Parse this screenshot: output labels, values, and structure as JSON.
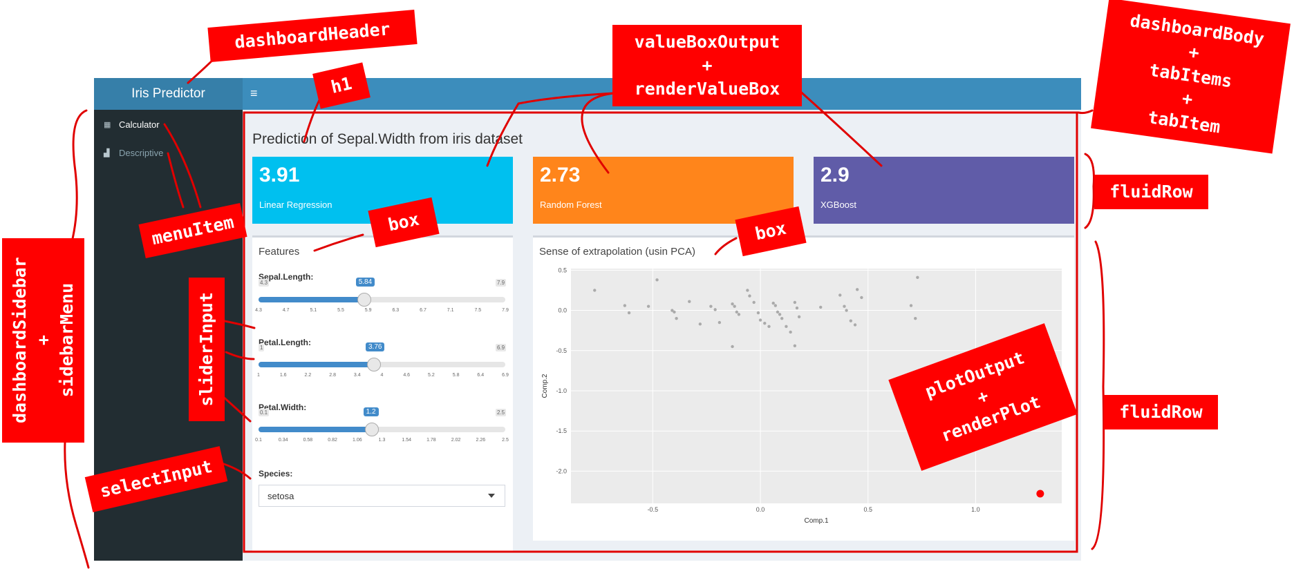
{
  "app": {
    "logo_title": "Iris Predictor",
    "hamburger_glyph": "≡",
    "page_title": "Prediction of Sepal.Width from iris dataset"
  },
  "sidebar": {
    "items": [
      {
        "label": "Calculator",
        "icon": "calculator-icon",
        "glyph": "▦"
      },
      {
        "label": "Descriptive",
        "icon": "bar-chart-icon",
        "glyph": "▟"
      }
    ]
  },
  "value_boxes": [
    {
      "value": "3.91",
      "label": "Linear Regression",
      "color": "#00c0ef"
    },
    {
      "value": "2.73",
      "label": "Random Forest",
      "color": "#ff851b"
    },
    {
      "value": "2.9",
      "label": "XGBoost",
      "color": "#605ca8"
    }
  ],
  "features": {
    "title": "Features",
    "sliders": [
      {
        "label": "Sepal.Length:",
        "min": 4.3,
        "max": 7.9,
        "value": 5.84,
        "min_label": "4.3",
        "max_label": "7.9",
        "value_label": "5.84",
        "ticks": [
          "4.3",
          "4.7",
          "5.1",
          "5.5",
          "5.9",
          "6.3",
          "6.7",
          "7.1",
          "7.5",
          "7.9"
        ]
      },
      {
        "label": "Petal.Length:",
        "min": 1,
        "max": 6.9,
        "value": 3.76,
        "min_label": "1",
        "max_label": "6.9",
        "value_label": "3.76",
        "ticks": [
          "1",
          "1.6",
          "2.2",
          "2.8",
          "3.4",
          "4",
          "4.6",
          "5.2",
          "5.8",
          "6.4",
          "6.9"
        ]
      },
      {
        "label": "Petal.Width:",
        "min": 0.1,
        "max": 2.5,
        "value": 1.2,
        "min_label": "0.1",
        "max_label": "2.5",
        "value_label": "1.2",
        "ticks": [
          "0.1",
          "0.34",
          "0.58",
          "0.82",
          "1.06",
          "1.3",
          "1.54",
          "1.78",
          "2.02",
          "2.26",
          "2.5"
        ]
      }
    ],
    "species_label": "Species:",
    "species_value": "setosa"
  },
  "plot_box": {
    "title": "Sense of extrapolation (usin PCA)"
  },
  "chart_data": {
    "type": "scatter",
    "title": "",
    "xlabel": "Comp.1",
    "ylabel": "Comp.2",
    "xlim": [
      -0.88,
      1.4
    ],
    "ylim": [
      -2.4,
      0.52
    ],
    "grid": true,
    "x_ticks": [
      -0.5,
      0.0,
      0.5,
      1.0
    ],
    "x_tick_labels": [
      "-0.5",
      "0.0",
      "0.5",
      "1.0"
    ],
    "y_ticks": [
      0.5,
      0.0,
      -0.5,
      -1.0,
      -1.5,
      -2.0
    ],
    "y_tick_labels": [
      "0.5",
      "0.0",
      "-0.5",
      "-1.0",
      "-1.5",
      "-2.0"
    ],
    "point_color": "#aaaaaa",
    "highlight_color": "#ff0000",
    "points": [
      [
        -0.77,
        0.25
      ],
      [
        -0.63,
        0.06
      ],
      [
        -0.61,
        -0.03
      ],
      [
        -0.52,
        0.05
      ],
      [
        -0.48,
        0.38
      ],
      [
        -0.41,
        0.0
      ],
      [
        -0.4,
        -0.02
      ],
      [
        -0.39,
        -0.1
      ],
      [
        -0.33,
        0.11
      ],
      [
        -0.28,
        -0.17
      ],
      [
        -0.23,
        0.05
      ],
      [
        -0.21,
        0.01
      ],
      [
        -0.19,
        -0.15
      ],
      [
        -0.13,
        0.08
      ],
      [
        -0.12,
        0.05
      ],
      [
        -0.11,
        -0.02
      ],
      [
        -0.1,
        -0.05
      ],
      [
        -0.06,
        0.25
      ],
      [
        -0.05,
        0.18
      ],
      [
        -0.03,
        0.1
      ],
      [
        -0.01,
        -0.03
      ],
      [
        0.0,
        -0.12
      ],
      [
        0.02,
        -0.16
      ],
      [
        0.04,
        -0.2
      ],
      [
        0.06,
        0.09
      ],
      [
        0.07,
        0.06
      ],
      [
        0.08,
        -0.02
      ],
      [
        0.09,
        -0.05
      ],
      [
        0.1,
        -0.1
      ],
      [
        0.12,
        -0.2
      ],
      [
        0.14,
        -0.27
      ],
      [
        0.16,
        0.1
      ],
      [
        0.17,
        0.03
      ],
      [
        0.18,
        -0.08
      ],
      [
        0.28,
        0.04
      ],
      [
        0.37,
        0.19
      ],
      [
        0.39,
        0.05
      ],
      [
        0.4,
        0.0
      ],
      [
        0.42,
        -0.13
      ],
      [
        0.44,
        -0.18
      ],
      [
        0.45,
        0.26
      ],
      [
        0.47,
        0.16
      ],
      [
        0.7,
        0.06
      ],
      [
        0.72,
        -0.1
      ],
      [
        0.73,
        0.41
      ],
      [
        -0.13,
        -0.45
      ],
      [
        0.16,
        -0.44
      ]
    ],
    "highlight_point": [
      1.3,
      -2.28
    ]
  },
  "annotations": [
    {
      "id": "dashboardHeader",
      "text": "dashboardHeader"
    },
    {
      "id": "h1",
      "text": "h1"
    },
    {
      "id": "valueBoxOutput",
      "text": "valueBoxOutput\n+\nrenderValueBox"
    },
    {
      "id": "dashboardBody",
      "text": "dashboardBody\n+\ntabItems\n+\ntabItem"
    },
    {
      "id": "fluidRow1",
      "text": "fluidRow"
    },
    {
      "id": "fluidRow2",
      "text": "fluidRow"
    },
    {
      "id": "box1",
      "text": "box"
    },
    {
      "id": "box2",
      "text": "box"
    },
    {
      "id": "menuItem",
      "text": "menuItem"
    },
    {
      "id": "dashboardSidebar",
      "text": "dashboardSidebar\n+\nsidebarMenu"
    },
    {
      "id": "sliderInput",
      "text": "sliderInput"
    },
    {
      "id": "selectInput",
      "text": "selectInput"
    },
    {
      "id": "plotOutput",
      "text": "plotOutput\n+\nrenderPlot"
    }
  ]
}
